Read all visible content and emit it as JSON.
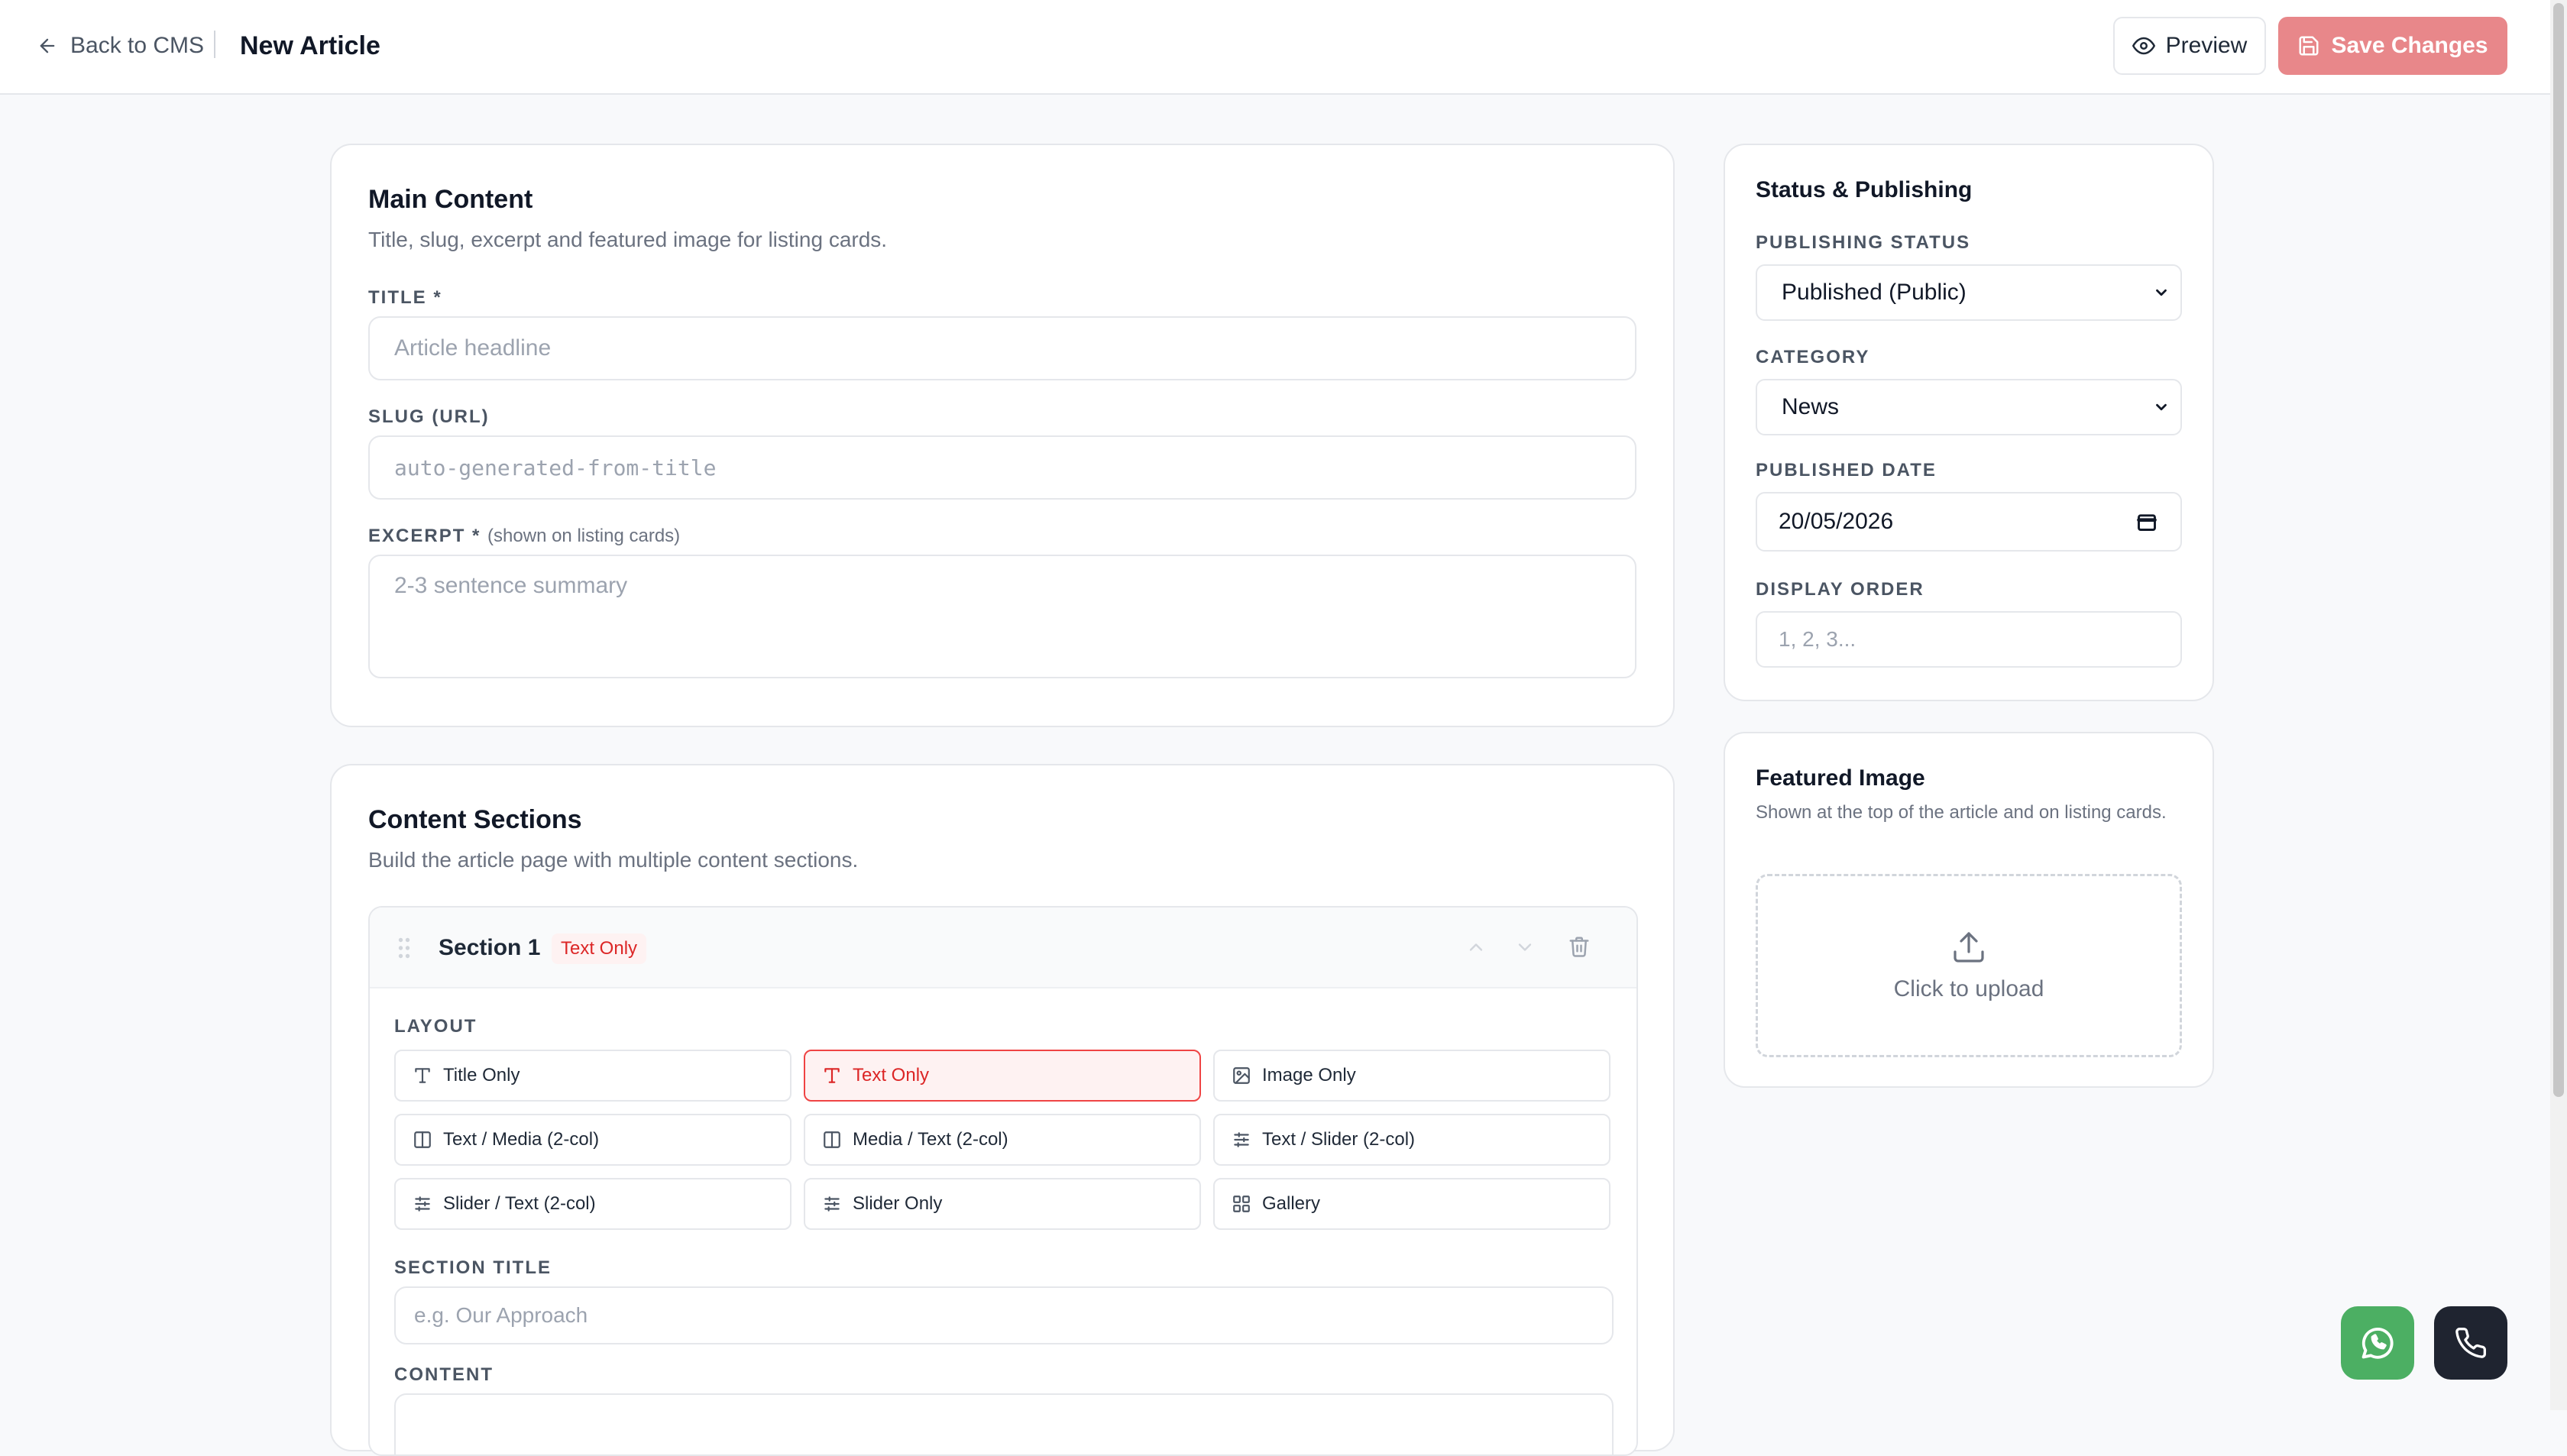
{
  "header": {
    "back_label": "Back to CMS",
    "title": "New Article",
    "preview_label": "Preview",
    "save_label": "Save Changes"
  },
  "main_content": {
    "title": "Main Content",
    "subtitle": "Title, slug, excerpt and featured image for listing cards.",
    "title_label": "TITLE *",
    "title_placeholder": "Article headline",
    "slug_label": "SLUG (URL)",
    "slug_placeholder": "auto-generated-from-title",
    "excerpt_label": "EXCERPT *",
    "excerpt_note": "(shown on listing cards)",
    "excerpt_placeholder": "2-3 sentence summary"
  },
  "content_sections": {
    "title": "Content Sections",
    "subtitle": "Build the article page with multiple content sections.",
    "section": {
      "name": "Section 1",
      "badge": "Text Only",
      "layout_label": "LAYOUT",
      "layouts": [
        {
          "label": "Title Only",
          "icon": "type-icon"
        },
        {
          "label": "Text Only",
          "icon": "type-icon",
          "active": true
        },
        {
          "label": "Image Only",
          "icon": "image-icon"
        },
        {
          "label": "Text / Media (2-col)",
          "icon": "columns-icon"
        },
        {
          "label": "Media / Text (2-col)",
          "icon": "columns-icon"
        },
        {
          "label": "Text / Slider (2-col)",
          "icon": "sliders-icon"
        },
        {
          "label": "Slider / Text (2-col)",
          "icon": "sliders-icon"
        },
        {
          "label": "Slider Only",
          "icon": "sliders-icon"
        },
        {
          "label": "Gallery",
          "icon": "grid-icon"
        }
      ],
      "section_title_label": "SECTION TITLE",
      "section_title_placeholder": "e.g. Our Approach",
      "content_label": "CONTENT"
    }
  },
  "status": {
    "title": "Status & Publishing",
    "publishing_status_label": "PUBLISHING STATUS",
    "publishing_status_value": "Published (Public)",
    "category_label": "CATEGORY",
    "category_value": "News",
    "published_date_label": "PUBLISHED DATE",
    "published_date_value": "20/05/2026",
    "display_order_label": "DISPLAY ORDER",
    "display_order_placeholder": "1, 2, 3..."
  },
  "featured_image": {
    "title": "Featured Image",
    "description": "Shown at the top of the article and on listing cards.",
    "upload_label": "Click to upload"
  },
  "colors": {
    "accent": "#e8878a",
    "badge_text": "#dc2626",
    "whatsapp": "#4caf63",
    "call_button": "#1f2430"
  }
}
